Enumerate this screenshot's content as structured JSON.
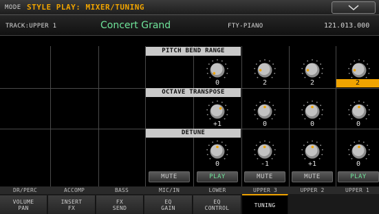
{
  "title": {
    "mode_label": "MODE",
    "page": "STYLE PLAY: MIXER/TUNING"
  },
  "track": {
    "label": "TRACK:UPPER 1",
    "sound_name": "Concert Grand",
    "bank": "FTY-PIANO",
    "program_number": "121.013.000"
  },
  "sections": {
    "pitch_bend": {
      "header": "PITCH BEND RANGE",
      "values": [
        "0",
        "2",
        "2",
        "2"
      ],
      "selected_index": 3
    },
    "octave": {
      "header": "OCTAVE TRANSPOSE",
      "values": [
        "+1",
        "0",
        "0",
        "0"
      ]
    },
    "detune": {
      "header": "DETUNE",
      "values": [
        "0",
        "-1",
        "+1",
        "0"
      ]
    }
  },
  "play_mute": [
    {
      "label": "MUTE",
      "state": "mute"
    },
    {
      "label": "PLAY",
      "state": "play"
    },
    {
      "label": "MUTE",
      "state": "mute"
    },
    {
      "label": "MUTE",
      "state": "mute"
    },
    {
      "label": "PLAY",
      "state": "play"
    }
  ],
  "channels": [
    "DR/PERC",
    "ACCOMP",
    "BASS",
    "MIC/IN",
    "LOWER",
    "UPPER 3",
    "UPPER 2",
    "UPPER 1"
  ],
  "tabs": [
    {
      "line1": "VOLUME",
      "line2": "PAN",
      "active": false
    },
    {
      "line1": "INSERT",
      "line2": "FX",
      "active": false
    },
    {
      "line1": "FX",
      "line2": "SEND",
      "active": false
    },
    {
      "line1": "EQ",
      "line2": "GAIN",
      "active": false
    },
    {
      "line1": "EQ",
      "line2": "CONTROL",
      "active": false
    },
    {
      "line1": "TUNING",
      "line2": "",
      "active": true
    }
  ],
  "colors": {
    "accent": "#f0a400",
    "green": "#6fe49a"
  }
}
